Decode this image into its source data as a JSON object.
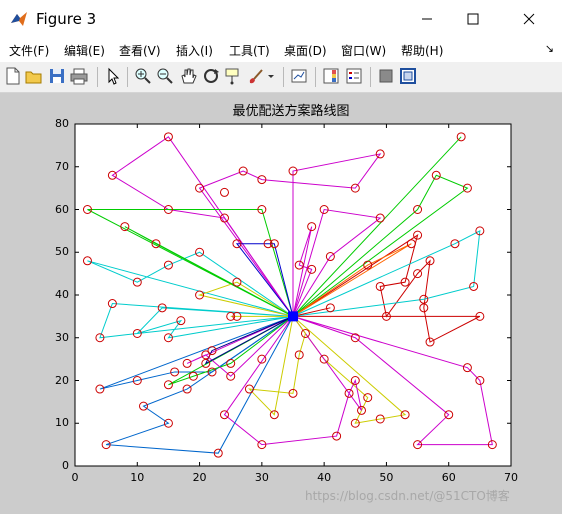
{
  "window": {
    "title": "Figure 3"
  },
  "menu": [
    {
      "label": "文件(F)"
    },
    {
      "label": "编辑(E)"
    },
    {
      "label": "查看(V)"
    },
    {
      "label": "插入(I)"
    },
    {
      "label": "工具(T)"
    },
    {
      "label": "桌面(D)"
    },
    {
      "label": "窗口(W)"
    },
    {
      "label": "帮助(H)"
    }
  ],
  "toolbar_icons": [
    "new-figure-icon",
    "open-file-icon",
    "save-icon",
    "print-icon",
    "edit-plot-icon",
    "zoom-in-icon",
    "zoom-out-icon",
    "pan-icon",
    "rotate-3d-icon",
    "data-cursor-icon",
    "brush-icon",
    "brush-dropdown-icon",
    "link-plot-icon",
    "insert-colorbar-icon",
    "insert-legend-icon",
    "hide-plot-tools-icon",
    "show-plot-tools-icon"
  ],
  "watermark": "https://blog.csdn.net/@51CTO博客",
  "chart_data": {
    "type": "scatter",
    "title": "最优配送方案路线图",
    "xlabel": "",
    "ylabel": "",
    "xlim": [
      0,
      70
    ],
    "ylim": [
      0,
      80
    ],
    "xticks": [
      0,
      10,
      20,
      30,
      40,
      50,
      60,
      70
    ],
    "yticks": [
      0,
      10,
      20,
      30,
      40,
      50,
      60,
      70,
      80
    ],
    "grid": false,
    "depot": {
      "x": 35,
      "y": 35
    },
    "customers": [
      [
        15,
        77
      ],
      [
        27,
        69
      ],
      [
        30,
        67
      ],
      [
        35,
        69
      ],
      [
        38,
        56
      ],
      [
        36,
        47
      ],
      [
        41,
        49
      ],
      [
        40,
        60
      ],
      [
        45,
        65
      ],
      [
        49,
        73
      ],
      [
        49,
        58
      ],
      [
        62,
        77
      ],
      [
        58,
        68
      ],
      [
        63,
        65
      ],
      [
        55,
        60
      ],
      [
        55,
        54
      ],
      [
        54,
        52
      ],
      [
        53,
        43
      ],
      [
        47,
        47
      ],
      [
        49,
        42
      ],
      [
        50,
        35
      ],
      [
        55,
        45
      ],
      [
        56,
        39
      ],
      [
        56,
        37
      ],
      [
        57,
        48
      ],
      [
        61,
        52
      ],
      [
        65,
        55
      ],
      [
        64,
        42
      ],
      [
        57,
        29
      ],
      [
        65,
        35
      ],
      [
        63,
        23
      ],
      [
        65,
        20
      ],
      [
        60,
        12
      ],
      [
        67,
        5
      ],
      [
        55,
        5
      ],
      [
        53,
        12
      ],
      [
        49,
        11
      ],
      [
        45,
        10
      ],
      [
        46,
        13
      ],
      [
        47,
        16
      ],
      [
        45,
        20
      ],
      [
        44,
        17
      ],
      [
        40,
        25
      ],
      [
        36,
        26
      ],
      [
        37,
        31
      ],
      [
        45,
        30
      ],
      [
        41,
        37
      ],
      [
        35,
        17
      ],
      [
        28,
        18
      ],
      [
        32,
        12
      ],
      [
        30,
        5
      ],
      [
        42,
        7
      ],
      [
        30,
        25
      ],
      [
        26,
        35
      ],
      [
        25,
        24
      ],
      [
        25,
        21
      ],
      [
        24,
        12
      ],
      [
        23,
        3
      ],
      [
        5,
        5
      ],
      [
        11,
        14
      ],
      [
        15,
        10
      ],
      [
        18,
        18
      ],
      [
        10,
        20
      ],
      [
        4,
        18
      ],
      [
        15,
        19
      ],
      [
        19,
        21
      ],
      [
        18,
        24
      ],
      [
        21,
        24
      ],
      [
        21,
        26
      ],
      [
        22,
        22
      ],
      [
        16,
        22
      ],
      [
        22,
        27
      ],
      [
        10,
        31
      ],
      [
        4,
        30
      ],
      [
        6,
        38
      ],
      [
        14,
        37
      ],
      [
        15,
        30
      ],
      [
        17,
        34
      ],
      [
        25,
        35
      ],
      [
        26,
        43
      ],
      [
        20,
        40
      ],
      [
        10,
        43
      ],
      [
        2,
        48
      ],
      [
        15,
        47
      ],
      [
        20,
        50
      ],
      [
        13,
        52
      ],
      [
        8,
        56
      ],
      [
        2,
        60
      ],
      [
        15,
        60
      ],
      [
        24,
        58
      ],
      [
        26,
        52
      ],
      [
        31,
        52
      ],
      [
        30,
        60
      ],
      [
        20,
        65
      ],
      [
        6,
        68
      ],
      [
        24,
        64
      ],
      [
        32,
        52
      ],
      [
        38,
        46
      ]
    ],
    "routes": [
      {
        "color": "#cc00cc",
        "points": [
          [
            35,
            35
          ],
          [
            15,
            77
          ],
          [
            6,
            68
          ],
          [
            15,
            60
          ],
          [
            24,
            58
          ],
          [
            35,
            35
          ]
        ]
      },
      {
        "color": "#cc00cc",
        "points": [
          [
            35,
            35
          ],
          [
            35,
            69
          ],
          [
            49,
            73
          ],
          [
            45,
            65
          ],
          [
            30,
            67
          ],
          [
            27,
            69
          ],
          [
            20,
            65
          ],
          [
            35,
            35
          ]
        ]
      },
      {
        "color": "#cc00cc",
        "points": [
          [
            35,
            35
          ],
          [
            40,
            60
          ],
          [
            49,
            58
          ],
          [
            41,
            49
          ],
          [
            35,
            35
          ]
        ]
      },
      {
        "color": "#00cc00",
        "points": [
          [
            35,
            35
          ],
          [
            62,
            77
          ],
          [
            35,
            35
          ]
        ]
      },
      {
        "color": "#00cc00",
        "points": [
          [
            35,
            35
          ],
          [
            63,
            65
          ],
          [
            58,
            68
          ],
          [
            55,
            60
          ],
          [
            35,
            35
          ]
        ]
      },
      {
        "color": "#00cc00",
        "points": [
          [
            35,
            35
          ],
          [
            30,
            60
          ],
          [
            15,
            60
          ],
          [
            2,
            60
          ],
          [
            35,
            35
          ]
        ]
      },
      {
        "color": "#cc0000",
        "points": [
          [
            35,
            35
          ],
          [
            55,
            54
          ],
          [
            53,
            43
          ],
          [
            49,
            42
          ],
          [
            50,
            35
          ],
          [
            55,
            45
          ],
          [
            57,
            48
          ],
          [
            56,
            37
          ],
          [
            57,
            29
          ],
          [
            65,
            35
          ],
          [
            35,
            35
          ]
        ]
      },
      {
        "color": "#ff6600",
        "points": [
          [
            35,
            35
          ],
          [
            54,
            52
          ],
          [
            47,
            47
          ],
          [
            35,
            35
          ]
        ]
      },
      {
        "color": "#00cccc",
        "points": [
          [
            35,
            35
          ],
          [
            61,
            52
          ],
          [
            65,
            55
          ],
          [
            64,
            42
          ],
          [
            56,
            39
          ],
          [
            35,
            35
          ]
        ]
      },
      {
        "color": "#00cccc",
        "points": [
          [
            35,
            35
          ],
          [
            2,
            48
          ],
          [
            10,
            43
          ],
          [
            15,
            47
          ],
          [
            20,
            50
          ],
          [
            35,
            35
          ]
        ]
      },
      {
        "color": "#00cccc",
        "points": [
          [
            35,
            35
          ],
          [
            14,
            37
          ],
          [
            10,
            31
          ],
          [
            4,
            30
          ],
          [
            6,
            38
          ],
          [
            35,
            35
          ]
        ]
      },
      {
        "color": "#cc00cc",
        "points": [
          [
            35,
            35
          ],
          [
            63,
            23
          ],
          [
            65,
            20
          ],
          [
            67,
            5
          ],
          [
            55,
            5
          ],
          [
            60,
            12
          ],
          [
            45,
            30
          ],
          [
            35,
            35
          ]
        ]
      },
      {
        "color": "#cccc00",
        "points": [
          [
            35,
            35
          ],
          [
            53,
            12
          ],
          [
            49,
            11
          ],
          [
            45,
            10
          ],
          [
            47,
            16
          ],
          [
            40,
            25
          ],
          [
            35,
            35
          ]
        ]
      },
      {
        "color": "#cc00cc",
        "points": [
          [
            35,
            35
          ],
          [
            46,
            13
          ],
          [
            45,
            20
          ],
          [
            44,
            17
          ],
          [
            42,
            7
          ],
          [
            30,
            5
          ],
          [
            24,
            12
          ],
          [
            35,
            35
          ]
        ]
      },
      {
        "color": "#cccc00",
        "points": [
          [
            35,
            35
          ],
          [
            37,
            31
          ],
          [
            36,
            26
          ],
          [
            35,
            17
          ],
          [
            28,
            18
          ],
          [
            32,
            12
          ],
          [
            35,
            35
          ]
        ]
      },
      {
        "color": "#0066cc",
        "points": [
          [
            35,
            35
          ],
          [
            23,
            3
          ],
          [
            5,
            5
          ],
          [
            15,
            10
          ],
          [
            11,
            14
          ],
          [
            18,
            18
          ],
          [
            35,
            35
          ]
        ]
      },
      {
        "color": "#0066cc",
        "points": [
          [
            35,
            35
          ],
          [
            22,
            22
          ],
          [
            16,
            22
          ],
          [
            10,
            20
          ],
          [
            4,
            18
          ],
          [
            35,
            35
          ]
        ]
      },
      {
        "color": "#00cccc",
        "points": [
          [
            35,
            35
          ],
          [
            15,
            30
          ],
          [
            17,
            34
          ],
          [
            10,
            31
          ],
          [
            35,
            35
          ]
        ]
      },
      {
        "color": "#00cc00",
        "points": [
          [
            35,
            35
          ],
          [
            25,
            24
          ],
          [
            19,
            21
          ],
          [
            15,
            19
          ],
          [
            35,
            35
          ]
        ]
      },
      {
        "color": "#cc00cc",
        "points": [
          [
            35,
            35
          ],
          [
            25,
            21
          ],
          [
            21,
            26
          ],
          [
            18,
            24
          ],
          [
            35,
            35
          ]
        ]
      },
      {
        "color": "#000088",
        "points": [
          [
            35,
            35
          ],
          [
            22,
            27
          ],
          [
            21,
            24
          ],
          [
            35,
            35
          ]
        ]
      },
      {
        "color": "#0000cc",
        "points": [
          [
            35,
            35
          ],
          [
            26,
            52
          ],
          [
            31,
            52
          ],
          [
            32,
            52
          ],
          [
            35,
            35
          ]
        ]
      },
      {
        "color": "#cccc00",
        "points": [
          [
            35,
            35
          ],
          [
            26,
            43
          ],
          [
            20,
            40
          ],
          [
            35,
            35
          ]
        ]
      },
      {
        "color": "#00cc00",
        "points": [
          [
            35,
            35
          ],
          [
            8,
            56
          ],
          [
            13,
            52
          ],
          [
            35,
            35
          ]
        ]
      },
      {
        "color": "#cccc00",
        "points": [
          [
            35,
            35
          ],
          [
            25,
            35
          ],
          [
            35,
            35
          ]
        ]
      },
      {
        "color": "#cc00cc",
        "points": [
          [
            35,
            35
          ],
          [
            38,
            56
          ],
          [
            36,
            47
          ],
          [
            38,
            46
          ],
          [
            35,
            35
          ]
        ]
      },
      {
        "color": "#cc0000",
        "points": [
          [
            35,
            35
          ],
          [
            41,
            37
          ],
          [
            35,
            35
          ]
        ]
      }
    ]
  }
}
